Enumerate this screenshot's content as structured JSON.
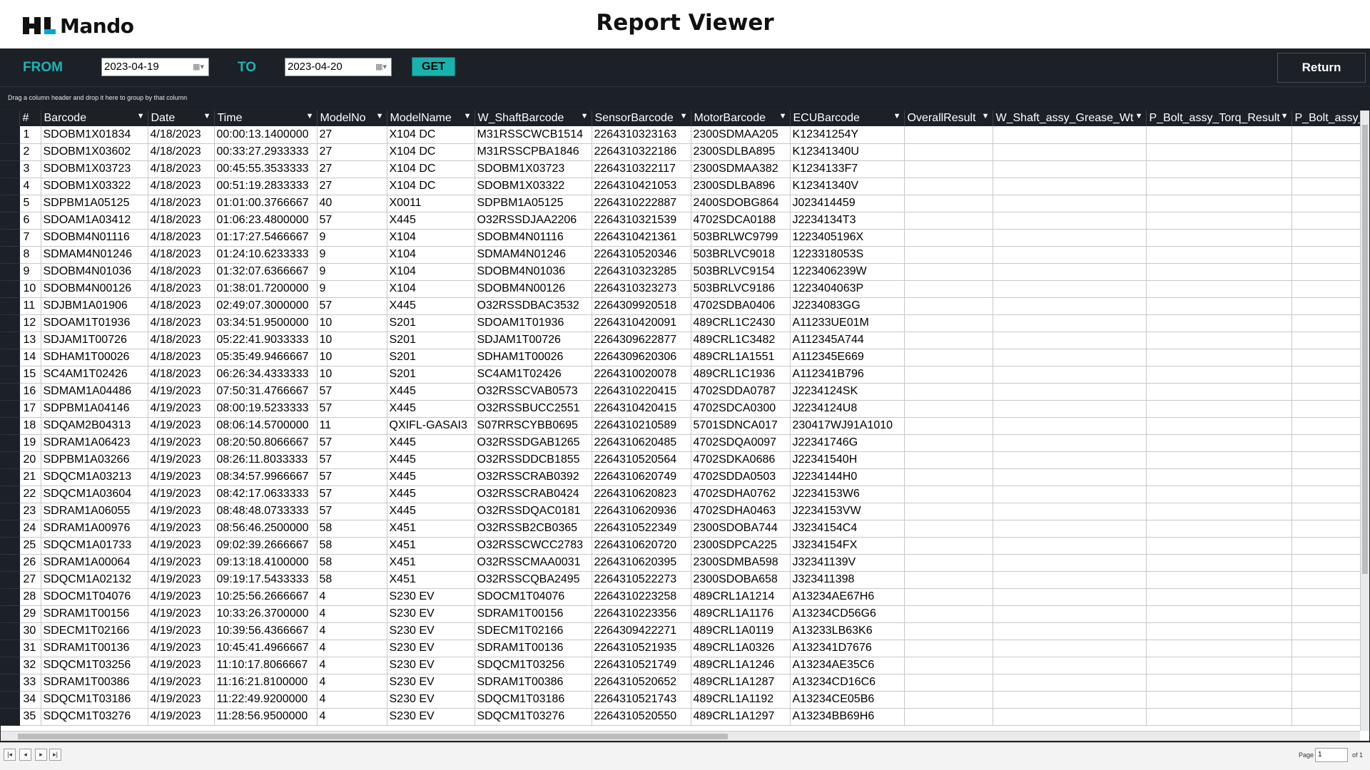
{
  "header": {
    "logo_text": "Mando",
    "logo_mark": "HL",
    "title": "Report Viewer"
  },
  "toolbar": {
    "from_label": "FROM",
    "from_date": "2023-04-19",
    "to_label": "TO",
    "to_date": "2023-04-20",
    "get_label": "GET",
    "return_label": "Return"
  },
  "group_panel": {
    "hint": "Drag a column header and drop it here to group by that column"
  },
  "columns": [
    "#",
    "Barcode",
    "Date",
    "Time",
    "ModelNo",
    "ModelName",
    "W_ShaftBarcode",
    "SensorBarcode",
    "MotorBarcode",
    "ECUBarcode",
    "OverallResult",
    "W_Shaft_assy_Grease_Wt",
    "P_Bolt_assy_Torq_Result",
    "P_Bolt_assy_"
  ],
  "rows": [
    [
      "1",
      "SDOBM1X01834",
      "4/18/2023",
      "00:00:13.1400000",
      "27",
      "X104 DC",
      "M31RSSCWCB1514",
      "2264310323163",
      "2300SDMAA205",
      "K12341254Y"
    ],
    [
      "2",
      "SDOBM1X03602",
      "4/18/2023",
      "00:33:27.2933333",
      "27",
      "X104 DC",
      "M31RSSCPBA1846",
      "2264310322186",
      "2300SDLBA895",
      "K12341340U"
    ],
    [
      "3",
      "SDOBM1X03723",
      "4/18/2023",
      "00:45:55.3533333",
      "27",
      "X104 DC",
      "SDOBM1X03723",
      "2264310322117",
      "2300SDMAA382",
      "K1234133F7"
    ],
    [
      "4",
      "SDOBM1X03322",
      "4/18/2023",
      "00:51:19.2833333",
      "27",
      "X104 DC",
      "SDOBM1X03322",
      "2264310421053",
      "2300SDLBA896",
      "K12341340V"
    ],
    [
      "5",
      "SDPBM1A05125",
      "4/18/2023",
      "01:01:00.3766667",
      "40",
      "X0011",
      "SDPBM1A05125",
      "2264310222887",
      "2400SDOBG864",
      "J023414459"
    ],
    [
      "6",
      "SDOAM1A03412",
      "4/18/2023",
      "01:06:23.4800000",
      "57",
      "X445",
      "O32RSSDJAA2206",
      "2264310321539",
      "4702SDCA0188",
      "J2234134T3"
    ],
    [
      "7",
      "SDOBM4N01116",
      "4/18/2023",
      "01:17:27.5466667",
      "9",
      "X104",
      "SDOBM4N01116",
      "2264310421361",
      "503BRLWC9799",
      "1223405196X"
    ],
    [
      "8",
      "SDMAM4N01246",
      "4/18/2023",
      "01:24:10.6233333",
      "9",
      "X104",
      "SDMAM4N01246",
      "2264310520346",
      "503BRLVC9018",
      "1223318053S"
    ],
    [
      "9",
      "SDOBM4N01036",
      "4/18/2023",
      "01:32:07.6366667",
      "9",
      "X104",
      "SDOBM4N01036",
      "2264310323285",
      "503BRLVC9154",
      "1223406239W"
    ],
    [
      "10",
      "SDOBM4N00126",
      "4/18/2023",
      "01:38:01.7200000",
      "9",
      "X104",
      "SDOBM4N00126",
      "2264310323273",
      "503BRLVC9186",
      "1223404063P"
    ],
    [
      "11",
      "SDJBM1A01906",
      "4/18/2023",
      "02:49:07.3000000",
      "57",
      "X445",
      "O32RSSDBAC3532",
      "2264309920518",
      "4702SDBA0406",
      "J2234083GG"
    ],
    [
      "12",
      "SDOAM1T01936",
      "4/18/2023",
      "03:34:51.9500000",
      "10",
      "S201",
      "SDOAM1T01936",
      "2264310420091",
      "489CRL1C2430",
      "A11233UE01M"
    ],
    [
      "13",
      "SDJAM1T00726",
      "4/18/2023",
      "05:22:41.9033333",
      "10",
      "S201",
      "SDJAM1T00726",
      "2264309622877",
      "489CRL1C3482",
      "A112345A744"
    ],
    [
      "14",
      "SDHAM1T00026",
      "4/18/2023",
      "05:35:49.9466667",
      "10",
      "S201",
      "SDHAM1T00026",
      "2264309620306",
      "489CRL1A1551",
      "A112345E669"
    ],
    [
      "15",
      "SC4AM1T02426",
      "4/18/2023",
      "06:26:34.4333333",
      "10",
      "S201",
      "SC4AM1T02426",
      "2264310020078",
      "489CRL1C1936",
      "A112341B796"
    ],
    [
      "16",
      "SDMAM1A04486",
      "4/19/2023",
      "07:50:31.4766667",
      "57",
      "X445",
      "O32RSSCVAB0573",
      "2264310220415",
      "4702SDDA0787",
      "J2234124SK"
    ],
    [
      "17",
      "SDPBM1A04146",
      "4/19/2023",
      "08:00:19.5233333",
      "57",
      "X445",
      "O32RSSBUCC2551",
      "2264310420415",
      "4702SDCA0300",
      "J2234124U8"
    ],
    [
      "18",
      "SDQAM2B04313",
      "4/19/2023",
      "08:06:14.5700000",
      "11",
      "QXIFL-GASAI3",
      "S07RRSCYBB0695",
      "2264310210589",
      "5701SDNCA017",
      "230417WJ91A1010"
    ],
    [
      "19",
      "SDRAM1A06423",
      "4/19/2023",
      "08:20:50.8066667",
      "57",
      "X445",
      "O32RSSDGAB1265",
      "2264310620485",
      "4702SDQA0097",
      "J22341746G"
    ],
    [
      "20",
      "SDPBM1A03266",
      "4/19/2023",
      "08:26:11.8033333",
      "57",
      "X445",
      "O32RSSDDCB1855",
      "2264310520564",
      "4702SDKA0686",
      "J22341540H"
    ],
    [
      "21",
      "SDQCM1A03213",
      "4/19/2023",
      "08:34:57.9966667",
      "57",
      "X445",
      "O32RSSCRAB0392",
      "2264310620749",
      "4702SDDA0503",
      "J2234144H0"
    ],
    [
      "22",
      "SDQCM1A03604",
      "4/19/2023",
      "08:42:17.0633333",
      "57",
      "X445",
      "O32RSSCRAB0424",
      "2264310620823",
      "4702SDHA0762",
      "J2234153W6"
    ],
    [
      "23",
      "SDRAM1A06055",
      "4/19/2023",
      "08:48:48.0733333",
      "57",
      "X445",
      "O32RSSDQAC0181",
      "2264310620936",
      "4702SDHA0463",
      "J2234153VW"
    ],
    [
      "24",
      "SDRAM1A00976",
      "4/19/2023",
      "08:56:46.2500000",
      "58",
      "X451",
      "O32RSSB2CB0365",
      "2264310522349",
      "2300SDOBA744",
      "J3234154C4"
    ],
    [
      "25",
      "SDQCM1A01733",
      "4/19/2023",
      "09:02:39.2666667",
      "58",
      "X451",
      "O32RSSCWCC2783",
      "2264310620720",
      "2300SDPCA225",
      "J3234154FX"
    ],
    [
      "26",
      "SDRAM1A00064",
      "4/19/2023",
      "09:13:18.4100000",
      "58",
      "X451",
      "O32RSSCMAA0031",
      "2264310620395",
      "2300SDMBA598",
      "J32341139V"
    ],
    [
      "27",
      "SDQCM1A02132",
      "4/19/2023",
      "09:19:17.5433333",
      "58",
      "X451",
      "O32RSSCQBA2495",
      "2264310522273",
      "2300SDOBA658",
      "J323411398"
    ],
    [
      "28",
      "SDOCM1T04076",
      "4/19/2023",
      "10:25:56.2666667",
      "4",
      "S230 EV",
      "SDOCM1T04076",
      "2264310223258",
      "489CRL1A1214",
      "A13234AE67H6"
    ],
    [
      "29",
      "SDRAM1T00156",
      "4/19/2023",
      "10:33:26.3700000",
      "4",
      "S230 EV",
      "SDRAM1T00156",
      "2264310223356",
      "489CRL1A1176",
      "A13234CD56G6"
    ],
    [
      "30",
      "SDECM1T02166",
      "4/19/2023",
      "10:39:56.4366667",
      "4",
      "S230 EV",
      "SDECM1T02166",
      "2264309422271",
      "489CRL1A0119",
      "A13233LB63K6"
    ],
    [
      "31",
      "SDRAM1T00136",
      "4/19/2023",
      "10:45:41.4966667",
      "4",
      "S230 EV",
      "SDRAM1T00136",
      "2264310521935",
      "489CRL1A0326",
      "A132341D7676"
    ],
    [
      "32",
      "SDQCM1T03256",
      "4/19/2023",
      "11:10:17.8066667",
      "4",
      "S230 EV",
      "SDQCM1T03256",
      "2264310521749",
      "489CRL1A1246",
      "A13234AE35C6"
    ],
    [
      "33",
      "SDRAM1T00386",
      "4/19/2023",
      "11:16:21.8100000",
      "4",
      "S230 EV",
      "SDRAM1T00386",
      "2264310520652",
      "489CRL1A1287",
      "A13234CD16C6"
    ],
    [
      "34",
      "SDQCM1T03186",
      "4/19/2023",
      "11:22:49.9200000",
      "4",
      "S230 EV",
      "SDQCM1T03186",
      "2264310521743",
      "489CRL1A1192",
      "A13234CE05B6"
    ],
    [
      "35",
      "SDQCM1T03276",
      "4/19/2023",
      "11:28:56.9500000",
      "4",
      "S230 EV",
      "SDQCM1T03276",
      "2264310520550",
      "489CRL1A1297",
      "A13234BB69H6"
    ]
  ],
  "pager": {
    "buttons": [
      "first-page-icon",
      "prev-page-icon",
      "next-page-icon",
      "last-page-icon"
    ],
    "page_label": "Page",
    "page_value": "1",
    "of_label": "of 1"
  },
  "colors": {
    "accent": "#1fb3b3",
    "toolbar_bg": "#1c2027",
    "get_button": "#19b3ad"
  }
}
